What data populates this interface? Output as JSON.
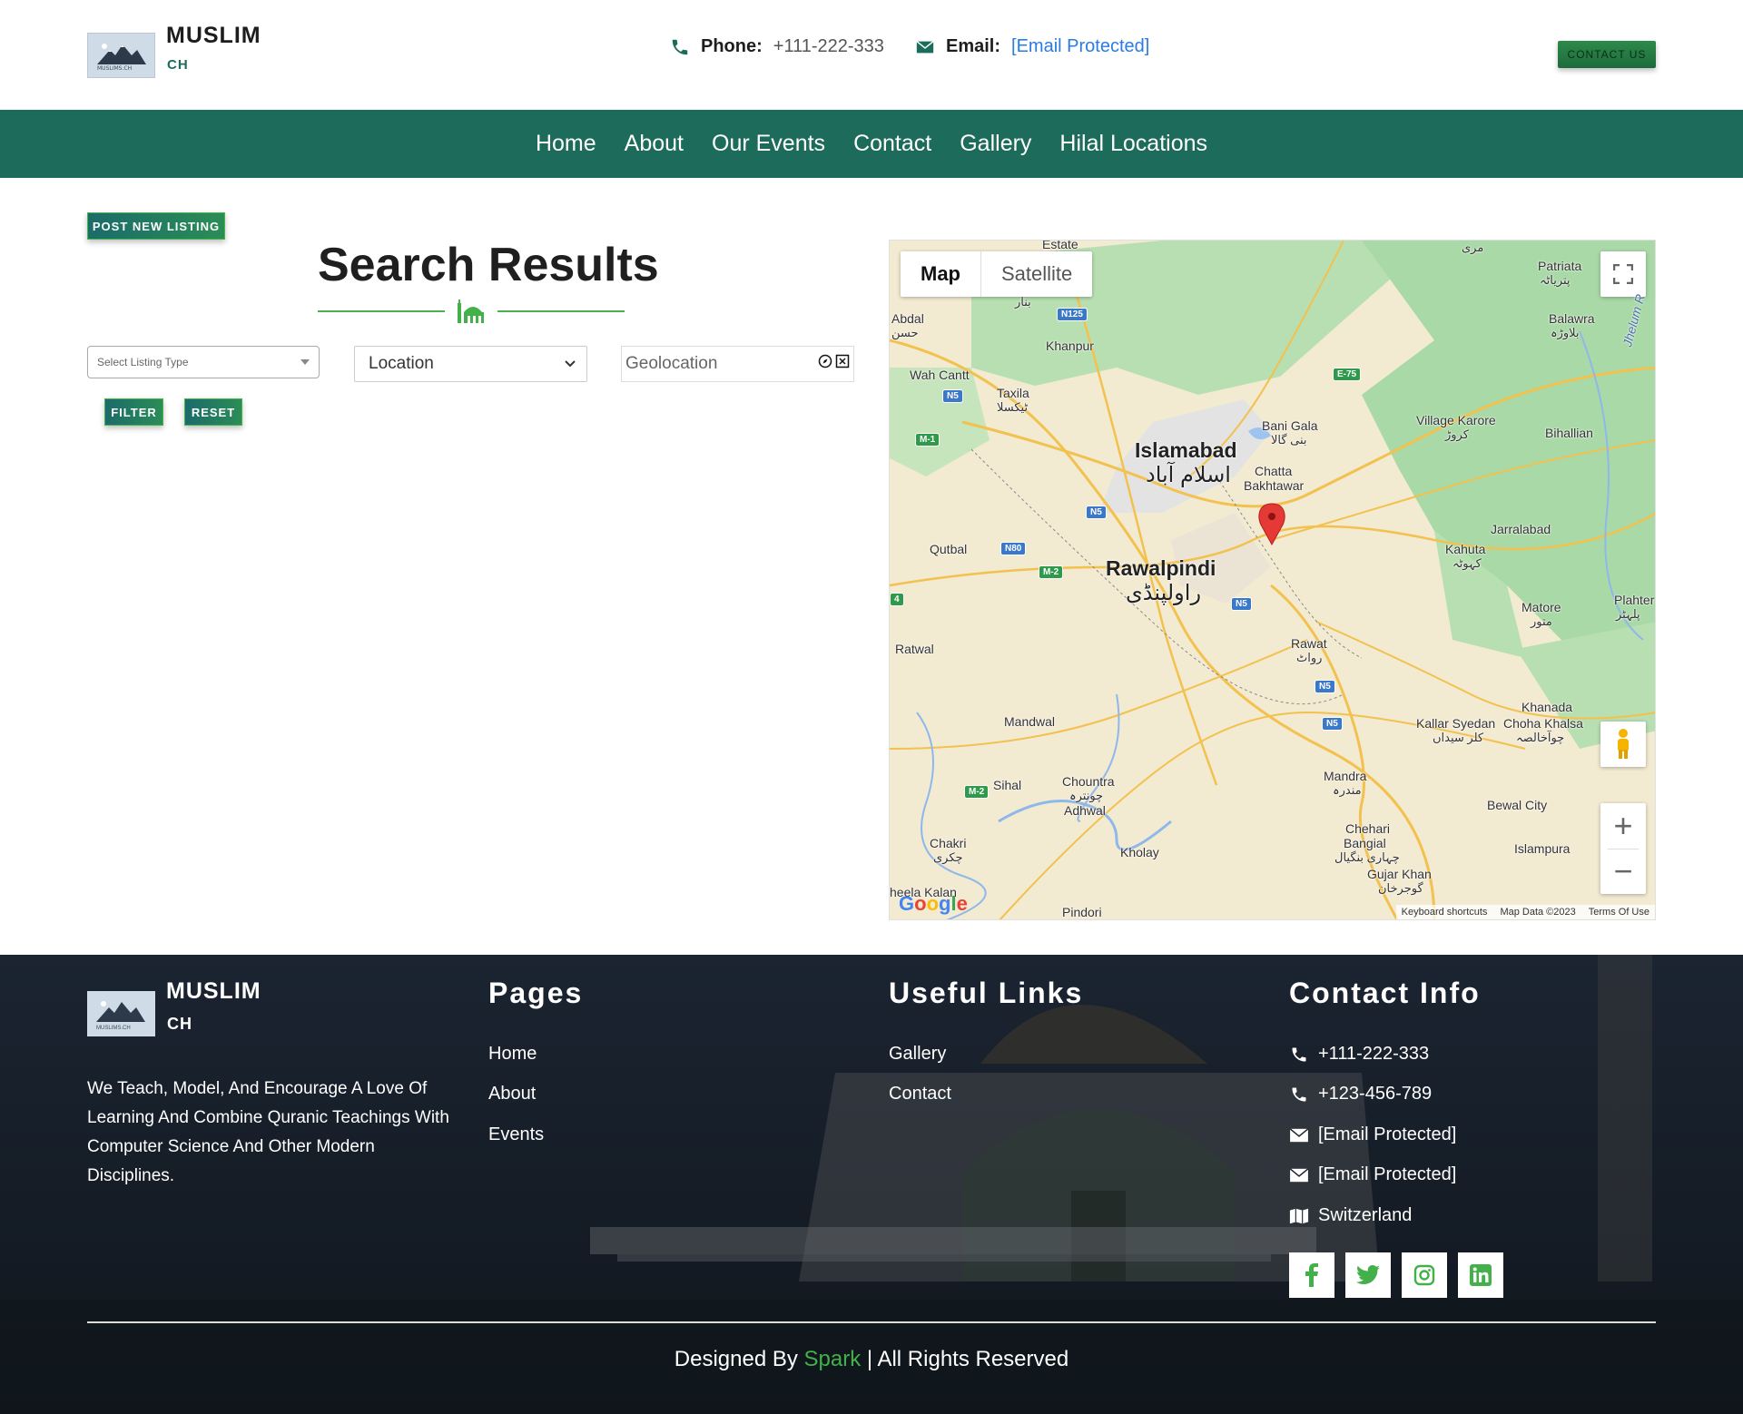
{
  "header": {
    "brand_title": "MUSLIM",
    "brand_sub": "CH",
    "logo_text": "MUSLIMS.CH",
    "phone_label": "Phone:",
    "phone_value": "+111-222-333",
    "email_label": "Email:",
    "email_value": "[Email Protected]",
    "contact_button": "CONTACT US"
  },
  "nav": {
    "items": [
      "Home",
      "About",
      "Our Events",
      "Contact",
      "Gallery",
      "Hilal Locations"
    ]
  },
  "main": {
    "post_listing_button": "POST NEW LISTING",
    "title": "Search Results",
    "listing_type_placeholder": "Select Listing Type",
    "location_select": "Location",
    "geolocation_placeholder": "Geolocation",
    "filter_button": "FILTER",
    "reset_button": "RESET"
  },
  "map": {
    "tab_map": "Map",
    "tab_satellite": "Satellite",
    "labels": {
      "estate": "Estate",
      "patriata": "Patriata",
      "patriata_ur": "پتریاٹہ",
      "abdal": "Abdal",
      "abdal_ur": "حسن",
      "khanpur": "Khanpur",
      "balawra": "Balawra",
      "balawra_ur": "بلاوڑہ",
      "wah_cantt": "Wah Cantt",
      "taxila": "Taxila",
      "taxila_ur": "ٹیکسلا",
      "bani_gala": "Bani Gala",
      "bani_gala_ur": "بنی گالا",
      "village_karore": "Village Karore",
      "village_karore_ur": "کروڑ",
      "bihallian": "Bihallian",
      "islamabad": "Islamabad",
      "islamabad_ur": "اسلام آباد",
      "chatta": "Chatta",
      "bakhtawar": "Bakhtawar",
      "jarralabad": "Jarralabad",
      "qutbal": "Qutbal",
      "kahuta": "Kahuta",
      "kahuta_ur": "کہوٹہ",
      "rawalpindi": "Rawalpindi",
      "rawalpindi_ur": "راولپنڈی",
      "plahter": "Plahter",
      "plahter_ur": "پلہٹر",
      "matore": "Matore",
      "matore_ur": "متور",
      "ratwal": "Ratwal",
      "rawat": "Rawat",
      "rawat_ur": "رواٹ",
      "khanada": "Khanada",
      "mandwal": "Mandwal",
      "kallar_syedan": "Kallar Syedan",
      "kallar_syedan_ur": "کلر سیداں",
      "choha_khalsa": "Choha Khalsa",
      "choha_khalsa_ur": "چوآخالصہ",
      "sihal": "Sihal",
      "chountra": "Chountra",
      "chountra_ur": "چونترہ",
      "adhwal": "Adhwal",
      "mandra": "Mandra",
      "mandra_ur": "مندرہ",
      "bewal_city": "Bewal City",
      "chakri": "Chakri",
      "chakri_ur": "چکری",
      "kholay": "Kholay",
      "chehari": "Chehari",
      "bangial": "Bangial",
      "chehari_ur": "چہاری بنگیال",
      "islampura": "Islampura",
      "gujar_khan": "Gujar Khan",
      "gujar_khan_ur": "گوجرخان",
      "heela_kalan": "heela Kalan",
      "pindori": "Pindori",
      "jhelum": "Jhelum R",
      "bannar_ur": "بنار",
      "marri_ur": "مری"
    },
    "shields": [
      "N125",
      "E-75",
      "N5",
      "M-1",
      "N5",
      "N80",
      "M-2",
      "N5",
      "N5",
      "N5",
      "M-2",
      "4"
    ],
    "google": "Google",
    "footer_shortcuts": "Keyboard shortcuts",
    "footer_data": "Map Data ©2023",
    "footer_terms": "Terms Of Use"
  },
  "footer": {
    "brand_title": "MUSLIM",
    "brand_sub": "CH",
    "logo_text": "MUSLIMS.CH",
    "about": "We Teach, Model, And Encourage A Love Of Learning And Combine Quranic Teachings With Computer Science And Other Modern Disciplines.",
    "pages_title": "Pages",
    "pages": [
      "Home",
      "About",
      "Events"
    ],
    "links_title": "Useful Links",
    "links": [
      "Gallery",
      "Contact"
    ],
    "contact_title": "Contact Info",
    "contacts": [
      "+111-222-333",
      "+123-456-789",
      "[Email Protected]",
      "[Email Protected]",
      "Switzerland"
    ],
    "credit_pre": "Designed By",
    "credit_name": "Spark",
    "credit_post": "| All Rights Reserved"
  },
  "colors": {
    "brand_green": "#1d6b5b",
    "accent_green": "#43b04a",
    "link_blue": "#2a7be4",
    "footer_bg": "#18202b"
  }
}
